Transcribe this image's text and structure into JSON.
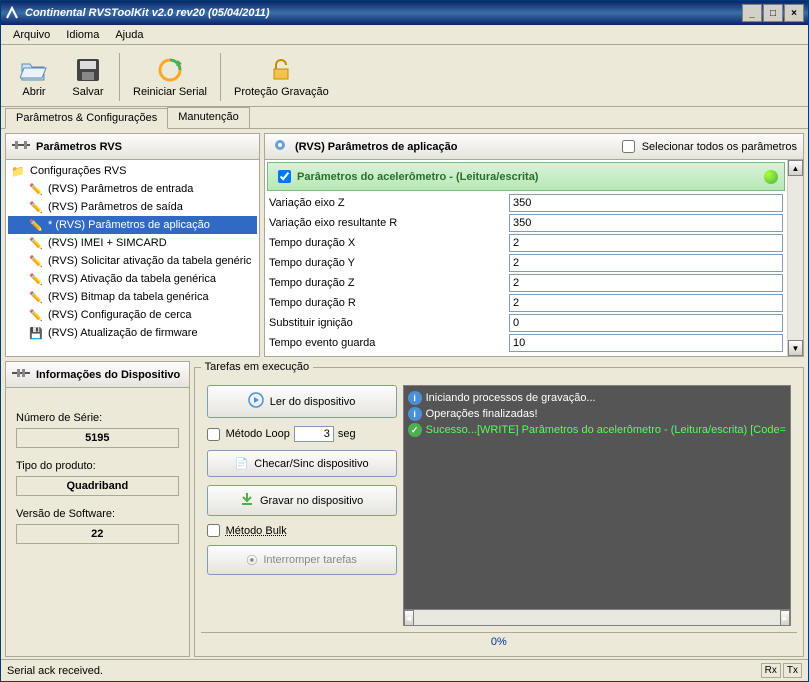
{
  "title": "Continental RVSToolKit v2.0 rev20 (05/04/2011)",
  "menu": {
    "arquivo": "Arquivo",
    "idioma": "Idioma",
    "ajuda": "Ajuda"
  },
  "toolbar": {
    "abrir": "Abrir",
    "salvar": "Salvar",
    "reiniciar": "Reiniciar Serial",
    "protecao": "Proteção Gravação"
  },
  "tabs": {
    "params": "Parâmetros & Configurações",
    "manut": "Manutenção"
  },
  "leftHeader": "Parâmetros RVS",
  "treeRoot": "Configurações RVS",
  "tree": [
    "(RVS) Parâmetros de entrada",
    "(RVS) Parâmetros de saída",
    "* (RVS) Parâmetros de aplicação",
    "(RVS) IMEI + SIMCARD",
    "(RVS) Solicitar ativação da tabela genéric",
    "(RVS) Ativação da tabela genérica",
    "(RVS) Bitmap da tabela genérica",
    "(RVS) Configuração de cerca",
    "(RVS) Atualização de firmware"
  ],
  "rightHeader": "(RVS) Parâmetros de aplicação",
  "selectAll": "Selecionar todos os parâmetros",
  "groupTitle": "Parâmetros do acelerômetro - (Leitura/escrita)",
  "params": [
    {
      "label": "Variação eixo Z",
      "value": "350"
    },
    {
      "label": "Variação eixo resultante R",
      "value": "350"
    },
    {
      "label": "Tempo duração X",
      "value": "2"
    },
    {
      "label": "Tempo duração Y",
      "value": "2"
    },
    {
      "label": "Tempo duração Z",
      "value": "2"
    },
    {
      "label": "Tempo duração R",
      "value": "2"
    },
    {
      "label": "Substituir ignição",
      "value": "0"
    },
    {
      "label": "Tempo evento guarda",
      "value": "10"
    }
  ],
  "devHeader": "Informações do Dispositivo",
  "dev": {
    "serieLabel": "Número de Série:",
    "serie": "5195",
    "tipoLabel": "Tipo do produto:",
    "tipo": "Quadriband",
    "versaoLabel": "Versão de Software:",
    "versao": "22"
  },
  "tasksTitle": "Tarefas em execução",
  "actions": {
    "ler": "Ler do dispositivo",
    "loop": "Método Loop",
    "loopVal": "3",
    "seg": "seg",
    "checar": "Checar/Sinc dispositivo",
    "gravar": "Gravar no dispositivo",
    "bulk": "Método Bulk",
    "interromper": "Interromper tarefas"
  },
  "log": [
    {
      "type": "info",
      "text": "Iniciando processos de gravação..."
    },
    {
      "type": "info",
      "text": "Operações finalizadas!"
    },
    {
      "type": "ok",
      "text": "Sucesso...[WRITE] Parâmetros do acelerômetro - (Leitura/escrita) [Code="
    }
  ],
  "progress": "0%",
  "status": "Serial ack received.",
  "rx": "Rx",
  "tx": "Tx"
}
